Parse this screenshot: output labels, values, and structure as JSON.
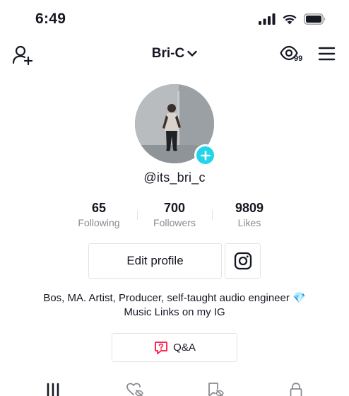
{
  "status_bar": {
    "time": "6:49",
    "icons": [
      "signal-icon",
      "wifi-icon",
      "battery-icon"
    ]
  },
  "header": {
    "title": "Bri-C",
    "views_count": "99",
    "icons": [
      "add-friend-icon",
      "chevron-down-icon",
      "eye-icon",
      "menu-icon"
    ]
  },
  "profile": {
    "username": "@its_bri_c",
    "avatar_badge_icon": "plus-icon",
    "accent_color": "#20d5ec"
  },
  "stats": [
    {
      "value": "65",
      "label": "Following"
    },
    {
      "value": "700",
      "label": "Followers"
    },
    {
      "value": "9809",
      "label": "Likes"
    }
  ],
  "actions": {
    "edit_profile_label": "Edit profile",
    "instagram_icon": "instagram-icon"
  },
  "bio": {
    "line1": "Bos, MA. Artist, Producer, self-taught audio engineer 💎",
    "line2": "Music Links on my IG"
  },
  "qa": {
    "label": "Q&A",
    "icon": "qa-icon",
    "icon_color": "#fe2c55"
  },
  "tabs": [
    {
      "name": "videos",
      "icon": "grid-icon",
      "active": true
    },
    {
      "name": "liked",
      "icon": "heart-hidden-icon",
      "active": false
    },
    {
      "name": "favorites",
      "icon": "bookmark-hidden-icon",
      "active": false
    },
    {
      "name": "private",
      "icon": "lock-icon",
      "active": false
    }
  ]
}
